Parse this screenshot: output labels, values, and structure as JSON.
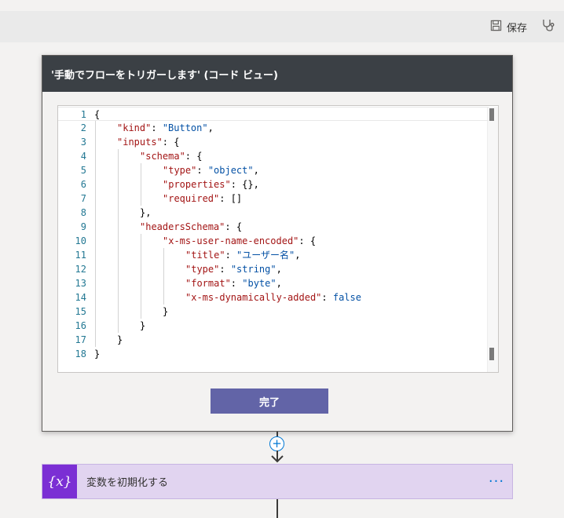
{
  "toolbar": {
    "save_label": "保存",
    "save_icon": "save-icon",
    "checker_icon": "stethoscope-icon"
  },
  "card": {
    "title": "'手動でフローをトリガーします' (コード ビュー)",
    "done_label": "完了"
  },
  "editor": {
    "lines": [
      {
        "num": "1",
        "indent": 0,
        "tokens": [
          {
            "t": "{",
            "c": "punct"
          }
        ]
      },
      {
        "num": "2",
        "indent": 1,
        "tokens": [
          {
            "t": "\"kind\"",
            "c": "key"
          },
          {
            "t": ": ",
            "c": "punct"
          },
          {
            "t": "\"Button\"",
            "c": "str"
          },
          {
            "t": ",",
            "c": "punct"
          }
        ]
      },
      {
        "num": "3",
        "indent": 1,
        "tokens": [
          {
            "t": "\"inputs\"",
            "c": "key"
          },
          {
            "t": ": {",
            "c": "punct"
          }
        ]
      },
      {
        "num": "4",
        "indent": 2,
        "tokens": [
          {
            "t": "\"schema\"",
            "c": "key"
          },
          {
            "t": ": {",
            "c": "punct"
          }
        ]
      },
      {
        "num": "5",
        "indent": 3,
        "tokens": [
          {
            "t": "\"type\"",
            "c": "key"
          },
          {
            "t": ": ",
            "c": "punct"
          },
          {
            "t": "\"object\"",
            "c": "str"
          },
          {
            "t": ",",
            "c": "punct"
          }
        ]
      },
      {
        "num": "6",
        "indent": 3,
        "tokens": [
          {
            "t": "\"properties\"",
            "c": "key"
          },
          {
            "t": ": {},",
            "c": "punct"
          }
        ]
      },
      {
        "num": "7",
        "indent": 3,
        "tokens": [
          {
            "t": "\"required\"",
            "c": "key"
          },
          {
            "t": ": []",
            "c": "punct"
          }
        ]
      },
      {
        "num": "8",
        "indent": 2,
        "tokens": [
          {
            "t": "},",
            "c": "punct"
          }
        ]
      },
      {
        "num": "9",
        "indent": 2,
        "tokens": [
          {
            "t": "\"headersSchema\"",
            "c": "key"
          },
          {
            "t": ": {",
            "c": "punct"
          }
        ]
      },
      {
        "num": "10",
        "indent": 3,
        "tokens": [
          {
            "t": "\"x-ms-user-name-encoded\"",
            "c": "key"
          },
          {
            "t": ": {",
            "c": "punct"
          }
        ]
      },
      {
        "num": "11",
        "indent": 4,
        "tokens": [
          {
            "t": "\"title\"",
            "c": "key"
          },
          {
            "t": ": ",
            "c": "punct"
          },
          {
            "t": "\"ユーザー名\"",
            "c": "str"
          },
          {
            "t": ",",
            "c": "punct"
          }
        ]
      },
      {
        "num": "12",
        "indent": 4,
        "tokens": [
          {
            "t": "\"type\"",
            "c": "key"
          },
          {
            "t": ": ",
            "c": "punct"
          },
          {
            "t": "\"string\"",
            "c": "str"
          },
          {
            "t": ",",
            "c": "punct"
          }
        ]
      },
      {
        "num": "13",
        "indent": 4,
        "tokens": [
          {
            "t": "\"format\"",
            "c": "key"
          },
          {
            "t": ": ",
            "c": "punct"
          },
          {
            "t": "\"byte\"",
            "c": "str"
          },
          {
            "t": ",",
            "c": "punct"
          }
        ]
      },
      {
        "num": "14",
        "indent": 4,
        "tokens": [
          {
            "t": "\"x-ms-dynamically-added\"",
            "c": "key"
          },
          {
            "t": ": ",
            "c": "punct"
          },
          {
            "t": "false",
            "c": "kw"
          }
        ]
      },
      {
        "num": "15",
        "indent": 3,
        "tokens": [
          {
            "t": "}",
            "c": "punct"
          }
        ]
      },
      {
        "num": "16",
        "indent": 2,
        "tokens": [
          {
            "t": "}",
            "c": "punct"
          }
        ]
      },
      {
        "num": "17",
        "indent": 1,
        "tokens": [
          {
            "t": "}",
            "c": "punct"
          }
        ]
      },
      {
        "num": "18",
        "indent": 0,
        "tokens": [
          {
            "t": "}",
            "c": "punct"
          }
        ]
      }
    ],
    "colors": {
      "key": "#a31515",
      "str": "#0451a5",
      "kw": "#0451a5",
      "punct": "#000000",
      "line_number": "#237893"
    }
  },
  "action": {
    "icon_label": "{x}",
    "title": "変数を初期化する",
    "menu_label": "···",
    "accent": "#7b2fd4"
  }
}
